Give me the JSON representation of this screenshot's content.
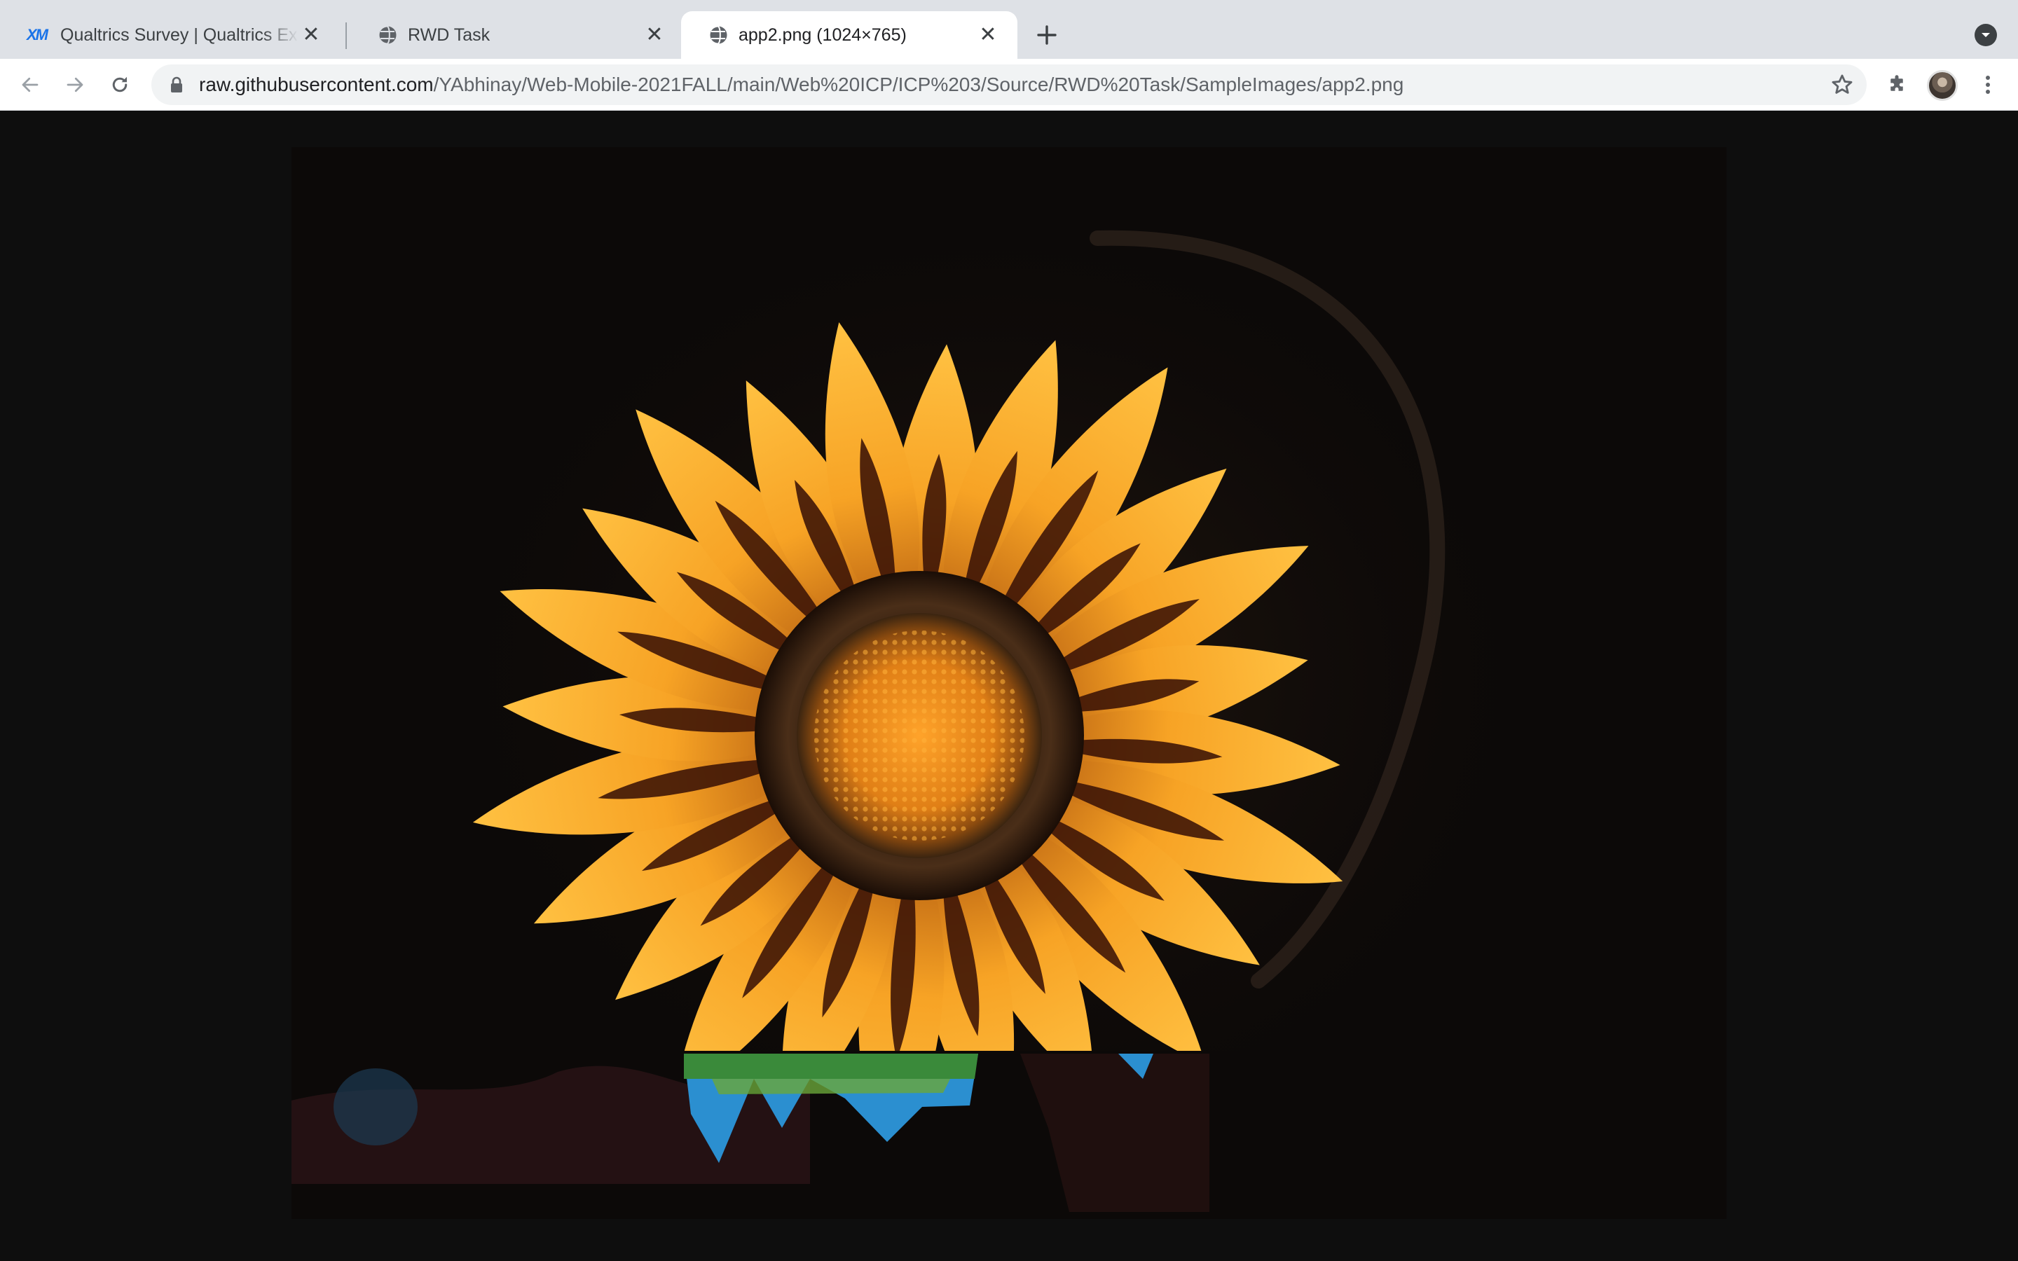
{
  "tabs": [
    {
      "title": "Qualtrics Survey | Qualtrics Experience Management",
      "icon": "qualtrics-xm-icon",
      "favicon_text": "XM",
      "active": false
    },
    {
      "title": "RWD Task",
      "icon": "globe-icon",
      "active": false
    },
    {
      "title": "app2.png (1024×765)",
      "icon": "globe-icon",
      "active": true
    }
  ],
  "address_bar": {
    "host": "raw.githubusercontent.com",
    "path": "/YAbhinay/Web-Mobile-2021FALL/main/Web%20ICP/ICP%203/Source/RWD%20Task/SampleImages/app2.png"
  },
  "content": {
    "image_description_icon": "flower-image",
    "page_background": "#0e0e0e"
  },
  "colors": {
    "tabstrip": "#dee1e6",
    "petal": "#f5a623",
    "petal_stripe": "#3a1206",
    "center": "#e8901c"
  }
}
